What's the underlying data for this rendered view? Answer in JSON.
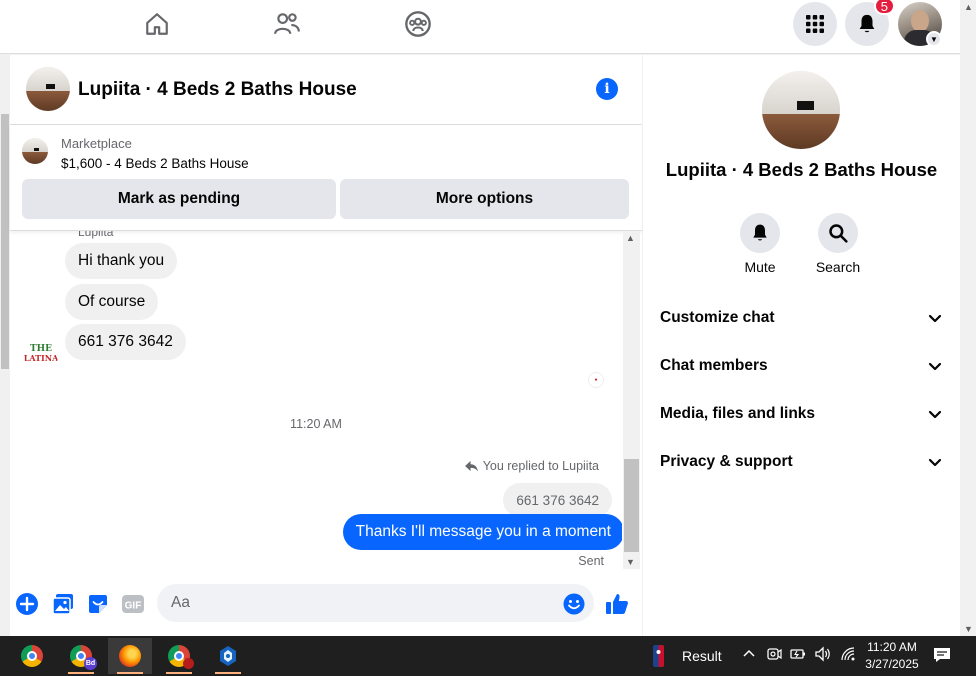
{
  "notifications": {
    "count": "5"
  },
  "chat": {
    "title": "Lupiita · 4 Beds 2 Baths House",
    "listing": {
      "source": "Marketplace",
      "title": "$1,600 - 4 Beds 2 Baths House",
      "pending_button": "Mark as pending",
      "options_button": "More options"
    },
    "sender_name": "Lupiita",
    "sender_logo": {
      "line1": "THE",
      "line2": "LATINA"
    },
    "messages_in": [
      "Hi thank you",
      "Of course",
      "661 376 3642"
    ],
    "timestamp": "11:20 AM",
    "replied_label": "You replied to Lupiita",
    "quoted_text": "661 376 3642",
    "outgoing": "Thanks I'll message you in a moment",
    "status": "Sent",
    "composer": {
      "placeholder": "Aa",
      "gif_label": "GIF"
    }
  },
  "info_pane": {
    "title": "Lupiita · 4 Beds 2 Baths House",
    "actions": [
      {
        "label": "Mute"
      },
      {
        "label": "Search"
      }
    ],
    "menu": [
      {
        "label": "Customize chat"
      },
      {
        "label": "Chat members"
      },
      {
        "label": "Media, files and links"
      },
      {
        "label": "Privacy & support"
      }
    ]
  },
  "taskbar": {
    "apps": [
      "chrome-icon",
      "chrome-profile-icon",
      "firefox-icon",
      "chrome-profile-icon",
      "app-icon"
    ],
    "chrome_profile_badge": "Bd",
    "result_label": "Result",
    "time": "11:20 AM",
    "date": "3/27/2025"
  },
  "colors": {
    "accent": "#0866ff",
    "badge": "#e41e3f"
  }
}
